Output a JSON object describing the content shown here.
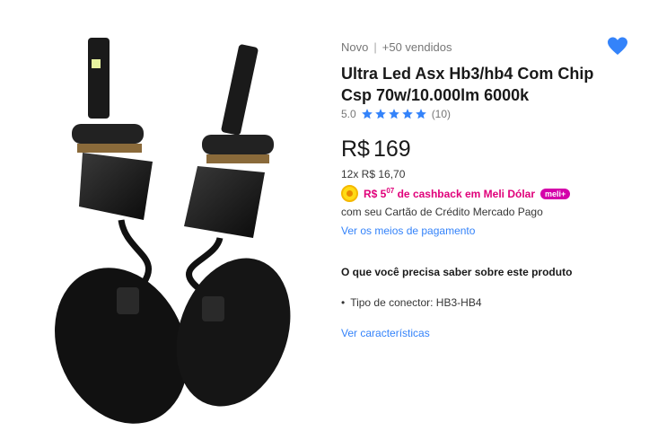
{
  "product": {
    "condition": "Novo",
    "separator": "|",
    "sold": "+50 vendidos",
    "title": "Ultra Led Asx Hb3/hb4 Com Chip Csp 70w/10.000lm 6000k",
    "rating_value": "5.0",
    "rating_stars": 5,
    "review_count": "(10)",
    "favorite_icon": "heart-icon"
  },
  "price": {
    "currency": "R$",
    "amount": "169",
    "installments": "12x R$ 16,70"
  },
  "cashback": {
    "prefix": "R$ 5",
    "cents": "07",
    "suffix": " de cashback em Meli Dólar",
    "badge": "meli+",
    "coin_icon": "coin-icon",
    "card_text": "com seu Cartão de Crédito Mercado Pago"
  },
  "payment": {
    "link": "Ver os meios de pagamento"
  },
  "features": {
    "title": "O que você precisa saber sobre este produto",
    "items": [
      {
        "label": "Tipo de conector: HB3-HB4"
      }
    ],
    "link": "Ver características"
  },
  "colors": {
    "accent_blue": "#3483fa",
    "cashback_pink": "#e0007a",
    "meli_badge": "#d400aa"
  }
}
